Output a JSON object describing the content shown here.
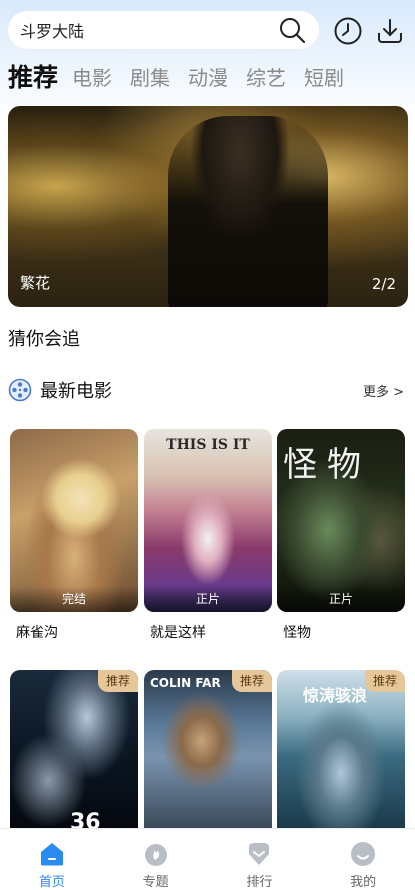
{
  "search": {
    "value": "斗罗大陆"
  },
  "tabs": [
    "推荐",
    "电影",
    "剧集",
    "动漫",
    "综艺",
    "短剧"
  ],
  "banner": {
    "title": "繁花",
    "counter": "2/2"
  },
  "guess_label": "猜你会追",
  "section": {
    "title": "最新电影",
    "more": "更多 >"
  },
  "movies_row1": [
    {
      "title": "麻雀沟",
      "badge": "完结"
    },
    {
      "title": "就是这样",
      "badge": "正片",
      "poster_text": "THIS IS IT"
    },
    {
      "title": "怪物",
      "badge": "正片",
      "poster_text": "怪物"
    }
  ],
  "movies_row2": [
    {
      "tag": "推荐",
      "poster_text": "36"
    },
    {
      "tag": "推荐",
      "poster_text": "COLIN FAR"
    },
    {
      "tag": "推荐",
      "poster_text": "惊涛骇浪"
    }
  ],
  "nav": [
    {
      "label": "首页",
      "icon": "home-icon"
    },
    {
      "label": "专题",
      "icon": "topic-icon"
    },
    {
      "label": "排行",
      "icon": "ranking-icon"
    },
    {
      "label": "我的",
      "icon": "profile-icon"
    }
  ],
  "colors": {
    "accent": "#2a8cf0",
    "tag_bg": "#e6c79a"
  }
}
